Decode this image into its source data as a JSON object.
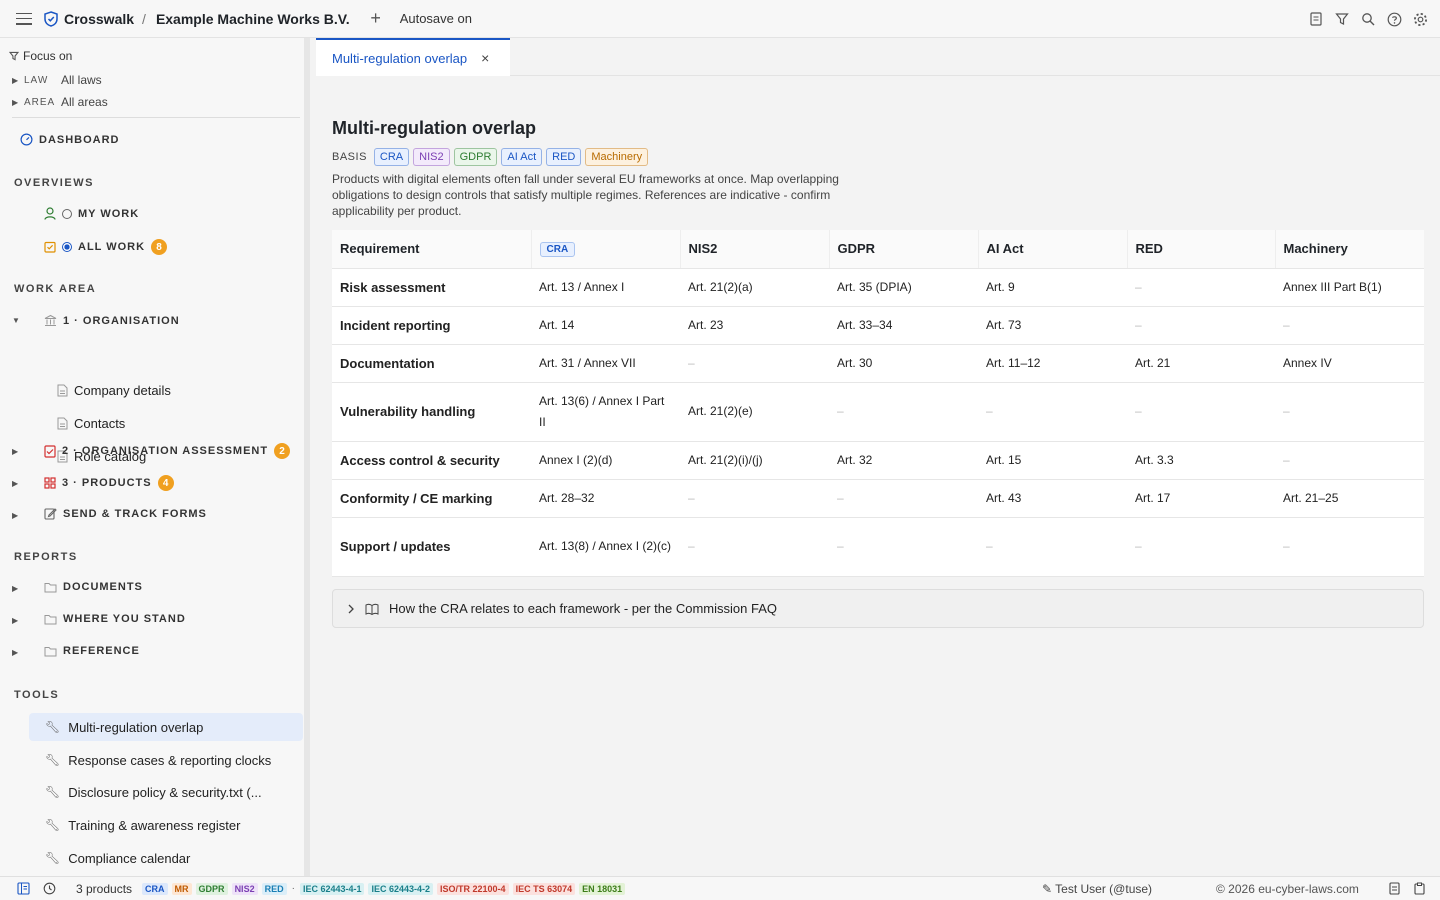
{
  "topbar": {
    "app_name": "Crosswalk",
    "separator": "/",
    "org_name": "Example Machine Works B.V.",
    "autosave": "Autosave on",
    "icons": [
      "document-icon",
      "filter-icon",
      "search-icon",
      "help-icon",
      "gear-icon"
    ]
  },
  "sidebar": {
    "focus_label": "Focus on",
    "filters": [
      {
        "label": "LAW",
        "value": "All laws"
      },
      {
        "label": "AREA",
        "value": "All areas"
      }
    ],
    "dashboard": "DASHBOARD",
    "overviews_heading": "OVERVIEWS",
    "my_work": "MY WORK",
    "all_work": "ALL WORK",
    "all_work_count": "8",
    "work_area_heading": "WORK AREA",
    "organisation": "1 · ORGANISATION",
    "org_children": [
      "Company details",
      "Contacts",
      "Role catalog"
    ],
    "org_assessment": "2 · ORGANISATION ASSESSMENT",
    "org_assessment_count": "2",
    "products": "3 · PRODUCTS",
    "products_count": "4",
    "send_track": "SEND & TRACK FORMS",
    "reports_heading": "REPORTS",
    "reports": [
      "DOCUMENTS",
      "WHERE YOU STAND",
      "REFERENCE"
    ],
    "tools_heading": "TOOLS",
    "tools": [
      "Multi-regulation overlap",
      "Response cases & reporting clocks",
      "Disclosure policy & security.txt (...",
      "Training & awareness register",
      "Compliance calendar"
    ]
  },
  "tab": {
    "label": "Multi-regulation overlap",
    "close": "×"
  },
  "main": {
    "title": "Multi-regulation overlap",
    "basis_label": "BASIS",
    "basis_chips": [
      {
        "label": "CRA",
        "color": "#1a56c4",
        "bg": "#e8f0fe"
      },
      {
        "label": "NIS2",
        "color": "#7b3fb3",
        "bg": "#f3eafb"
      },
      {
        "label": "GDPR",
        "color": "#2e7d32",
        "bg": "#eaf6ea"
      },
      {
        "label": "AI Act",
        "color": "#1a56c4",
        "bg": "#e8f0fe"
      },
      {
        "label": "RED",
        "color": "#1a56c4",
        "bg": "#e8f0fe"
      },
      {
        "label": "Machinery",
        "color": "#b86b00",
        "bg": "#fdf1df"
      }
    ],
    "description": "Products with digital elements often fall under several EU frameworks at once. Map overlapping obligations to design controls that satisfy multiple regimes. References are indicative - confirm applicability per product.",
    "table": {
      "headers": [
        "Requirement",
        "CRA",
        "NIS2",
        "GDPR",
        "AI Act",
        "RED",
        "Machinery"
      ],
      "rows": [
        [
          "Risk assessment",
          "Art. 13 / Annex I",
          "Art. 21(2)(a)",
          "Art. 35 (DPIA)",
          "Art. 9",
          "–",
          "Annex III Part B(1)"
        ],
        [
          "Incident reporting",
          "Art. 14",
          "Art. 23",
          "Art. 33–34",
          "Art. 73",
          "–",
          "–"
        ],
        [
          "Documentation",
          "Art. 31 / Annex VII",
          "–",
          "Art. 30",
          "Art. 11–12",
          "Art. 21",
          "Annex IV"
        ],
        [
          "Vulnerability handling",
          "Art. 13(6) / Annex I Part II",
          "Art. 21(2)(e)",
          "–",
          "–",
          "–",
          "–"
        ],
        [
          "Access control & security",
          "Annex I (2)(d)",
          "Art. 21(2)(i)/(j)",
          "Art. 32",
          "Art. 15",
          "Art. 3.3",
          "–"
        ],
        [
          "Conformity / CE marking",
          "Art. 28–32",
          "–",
          "–",
          "Art. 43",
          "Art. 17",
          "Art. 21–25"
        ],
        [
          "Support / updates",
          "Art. 13(8) / Annex I (2)(c)",
          "–",
          "–",
          "–",
          "–",
          "–"
        ]
      ]
    },
    "faq_label": "How the CRA relates to each framework - per the Commission FAQ"
  },
  "statusbar": {
    "products": "3 products",
    "law_tags": [
      {
        "label": "CRA",
        "color": "#1a56c4",
        "bg": "#dce8fb"
      },
      {
        "label": "MR",
        "color": "#c05a00",
        "bg": "#fde6d3"
      },
      {
        "label": "GDPR",
        "color": "#2e7d32",
        "bg": "#dff1df"
      },
      {
        "label": "NIS2",
        "color": "#7b3fb3",
        "bg": "#eee2f8"
      },
      {
        "label": "RED",
        "color": "#1a7fb5",
        "bg": "#dbeef8"
      }
    ],
    "dot": "·",
    "std_tags": [
      {
        "label": "IEC 62443-4-1",
        "color": "#1a7f8a",
        "bg": "#d8f0f2"
      },
      {
        "label": "IEC 62443-4-2",
        "color": "#1a7f8a",
        "bg": "#d8f0f2"
      },
      {
        "label": "ISO/TR 22100-4",
        "color": "#c0392b",
        "bg": "#fbe1de"
      },
      {
        "label": "IEC TS 63074",
        "color": "#c0392b",
        "bg": "#fbe1de"
      },
      {
        "label": "EN 18031",
        "color": "#3d7d1a",
        "bg": "#e3f2d6"
      }
    ],
    "user": "✎ Test User (@tuse)",
    "copyright": "© 2026 eu-cyber-laws.com"
  }
}
